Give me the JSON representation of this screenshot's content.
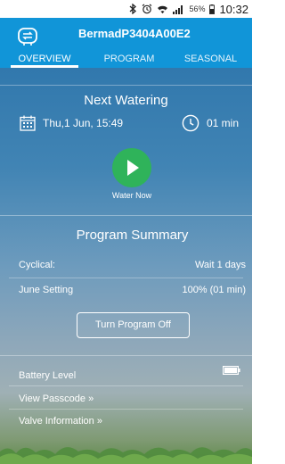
{
  "status_bar": {
    "battery_percent": "56%",
    "time": "10:32"
  },
  "header": {
    "device_name": "BermadP3404A00E2",
    "tabs": [
      {
        "label": "OVERVIEW",
        "active": true
      },
      {
        "label": "PROGRAM",
        "active": false
      },
      {
        "label": "SEASONAL",
        "active": false
      }
    ],
    "color": "#1195d8"
  },
  "next_watering": {
    "title": "Next Watering",
    "date": "Thu,1 Jun, 15:49",
    "duration": "01 min"
  },
  "water_now": {
    "label": "Water Now",
    "color": "#2fb35a"
  },
  "program_summary": {
    "title": "Program Summary",
    "rows": [
      {
        "label": "Cyclical:",
        "value": "Wait 1 days"
      },
      {
        "label": "June Setting",
        "value": "100%  (01 min)"
      }
    ],
    "toggle_button": "Turn Program Off"
  },
  "links": {
    "battery": "Battery Level",
    "passcode": "View Passcode »",
    "valve": "Valve Information »"
  }
}
